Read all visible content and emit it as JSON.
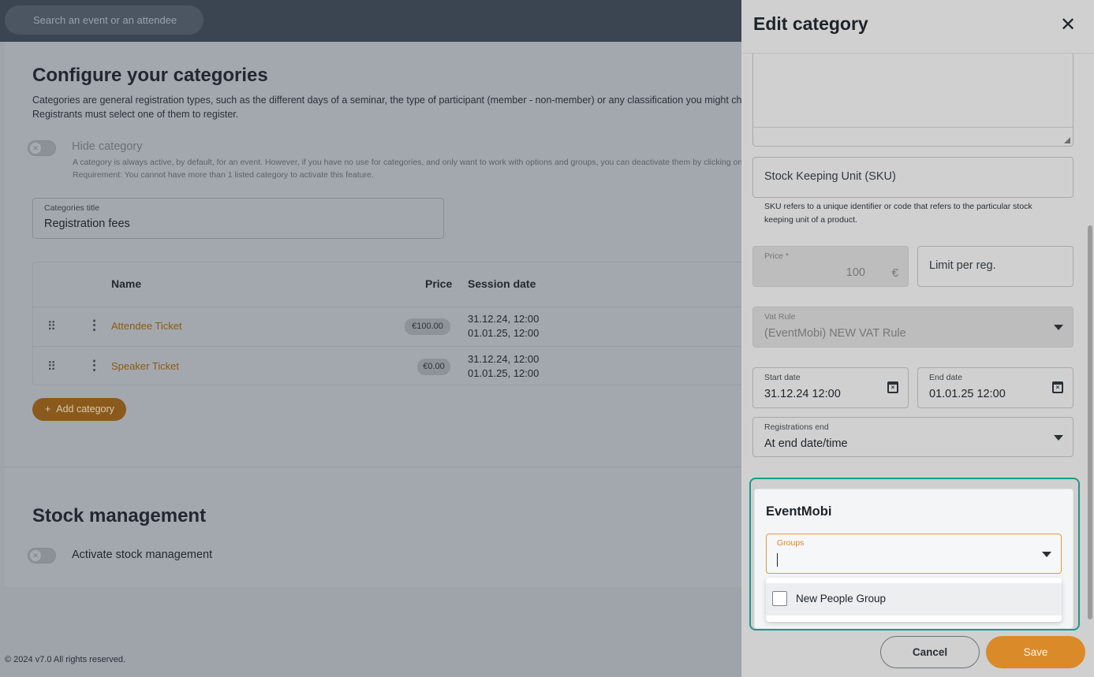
{
  "topbar": {
    "search_placeholder": "Search an event or an attendee"
  },
  "page": {
    "title": "Configure your categories",
    "description_line1": "Categories are general registration types, such as the different days of a seminar, the type of participant (member - non-member) or any classification you might choose, in li",
    "description_line2": "Registrants must select one of them to register.",
    "hide_category": {
      "label": "Hide category",
      "help_line1": "A category is always active, by default, for an event. However, if you have no use for categories, and only want to work with options and groups, you can deactivate them by clicking on th",
      "help_line2": "Requirement: You cannot have more than 1 listed category to activate this feature.",
      "enabled": false
    },
    "categories_title": {
      "label": "Categories title",
      "value": "Registration fees"
    },
    "table": {
      "headers": {
        "name": "Name",
        "price": "Price",
        "session_date": "Session date"
      },
      "rows": [
        {
          "name": "Attendee Ticket",
          "price": "€100.00",
          "session_start": "31.12.24, 12:00",
          "session_end": "01.01.25, 12:00"
        },
        {
          "name": "Speaker Ticket",
          "price": "€0.00",
          "session_start": "31.12.24, 12:00",
          "session_end": "01.01.25, 12:00"
        }
      ]
    },
    "add_category_label": "Add category",
    "stock_title": "Stock management",
    "stock_toggle_label": "Activate stock management",
    "footer": "© 2024 v7.0 All rights reserved."
  },
  "drawer": {
    "title": "Edit category",
    "sku": {
      "placeholder": "Stock Keeping Unit (SKU)",
      "help": "SKU refers to a unique identifier or code that refers to the particular stock keeping unit of a product."
    },
    "price": {
      "label": "Price *",
      "value": "100",
      "currency": "€"
    },
    "limit_placeholder": "Limit per reg.",
    "vat_rule": {
      "label": "Vat Rule",
      "value": "(EventMobi) NEW VAT Rule"
    },
    "start_date": {
      "label": "Start date",
      "value": "31.12.24 12:00"
    },
    "end_date": {
      "label": "End date",
      "value": "01.01.25 12:00"
    },
    "registrations_end": {
      "label": "Registrations end",
      "value": "At end date/time"
    },
    "eventmobi": {
      "title": "EventMobi",
      "groups_label": "Groups",
      "options": [
        "New People Group"
      ]
    },
    "cancel_label": "Cancel",
    "save_label": "Save"
  },
  "colors": {
    "accent": "#db8a2a",
    "highlight": "#1a9b8a"
  }
}
